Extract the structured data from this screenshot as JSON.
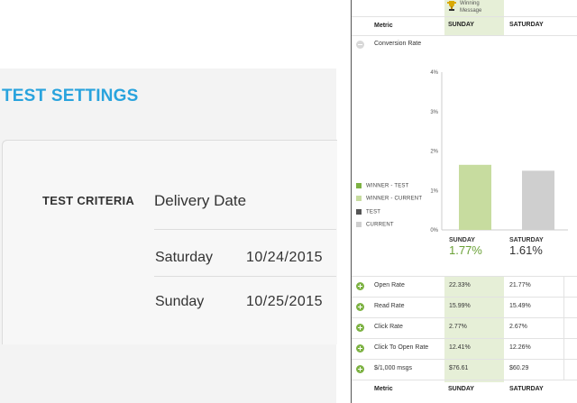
{
  "left": {
    "title": "TEST SETTINGS",
    "criteria_label": "TEST CRITERIA",
    "criteria_value": "Delivery Date",
    "options": [
      {
        "day": "Saturday",
        "date": "10/24/2015"
      },
      {
        "day": "Sunday",
        "date": "10/25/2015"
      }
    ]
  },
  "right": {
    "winning_message": "Winning Message",
    "header": {
      "metric": "Metric",
      "col1": "SUNDAY",
      "col2": "SATURDAY"
    },
    "conversion_label": "Conversion Rate",
    "legend": [
      {
        "label": "WINNER - TEST",
        "color": "#7db243"
      },
      {
        "label": "WINNER - CURRENT",
        "color": "#c7dc9f"
      },
      {
        "label": "TEST",
        "color": "#555555"
      },
      {
        "label": "CURRENT",
        "color": "#cfcfcf"
      }
    ],
    "summary": [
      {
        "day": "SUNDAY",
        "value": "1.77%",
        "color": "#6aa136"
      },
      {
        "day": "SATURDAY",
        "value": "1.61%",
        "color": "#333333"
      }
    ],
    "metrics": [
      {
        "label": "Open Rate",
        "v1": "22.33%",
        "v2": "21.77%"
      },
      {
        "label": "Read Rate",
        "v1": "15.99%",
        "v2": "15.49%"
      },
      {
        "label": "Click Rate",
        "v1": "2.77%",
        "v2": "2.67%"
      },
      {
        "label": "Click To Open Rate",
        "v1": "12.41%",
        "v2": "12.26%"
      },
      {
        "label": "$/1,000 msgs",
        "v1": "$76.61",
        "v2": "$60.29"
      }
    ],
    "footer": {
      "metric": "Metric",
      "col1": "SUNDAY",
      "col2": "SATURDAY"
    }
  },
  "chart_data": {
    "type": "bar",
    "categories": [
      "SUNDAY",
      "SATURDAY"
    ],
    "values": [
      1.65,
      1.5
    ],
    "colors": [
      "#c7dc9f",
      "#cfcfcf"
    ],
    "ytick_labels": [
      "4%",
      "3%",
      "2%",
      "1%",
      "0%"
    ],
    "ylim": [
      0,
      4
    ],
    "title": "",
    "xlabel": "",
    "ylabel": ""
  }
}
